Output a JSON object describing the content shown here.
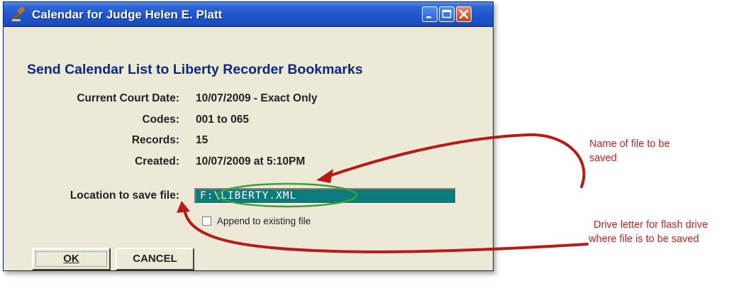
{
  "window": {
    "title": "Calendar for Judge Helen E. Platt",
    "icon": "gavel-icon",
    "controls": [
      "minimize-icon",
      "maximize-icon",
      "close-icon"
    ]
  },
  "dialog": {
    "heading": "Send Calendar List to Liberty Recorder Bookmarks",
    "rows": [
      {
        "label": "Current Court Date:",
        "value": "10/07/2009 - Exact Only"
      },
      {
        "label": "Codes:",
        "value": "001 to 065"
      },
      {
        "label": "Records:",
        "value": "15"
      },
      {
        "label": "Created:",
        "value": "10/07/2009 at 5:10PM"
      }
    ],
    "location_label": "Location to save file:",
    "location_value": "F:\\LIBERTY.XML",
    "append_label": "Append to existing file",
    "append_checked": false,
    "ok_label": "OK",
    "cancel_label": "CANCEL"
  },
  "annotations": {
    "file_name": {
      "line1": "Name of file to be",
      "line2": "saved"
    },
    "drive_letter": {
      "line1": "Drive letter for flash drive",
      "line2": "where file is to be saved"
    }
  },
  "colors": {
    "titlebar": "#1f57d0",
    "dialog_bg": "#ece9d8",
    "input_bg": "#0b7b7b",
    "heading": "#0a2a7c",
    "annotation": "#c8231f",
    "highlight_ellipse": "#39a035"
  }
}
